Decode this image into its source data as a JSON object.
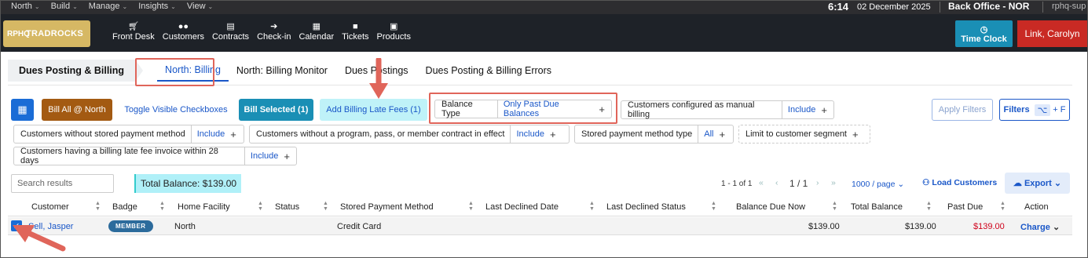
{
  "topbar": {
    "menus": [
      "North",
      "Build",
      "Manage",
      "Insights",
      "View"
    ],
    "clock": "6:14",
    "date": "02 December 2025",
    "office": "Back Office - NOR",
    "user": "rphq-sup"
  },
  "nav": {
    "logo_mono": "RPHQ",
    "logo_text": "TRADROCKS",
    "items": [
      {
        "label": "Front Desk",
        "icon": "cart-icon"
      },
      {
        "label": "Customers",
        "icon": "users-icon"
      },
      {
        "label": "Contracts",
        "icon": "contract-icon"
      },
      {
        "label": "Check-in",
        "icon": "check-in-icon"
      },
      {
        "label": "Calendar",
        "icon": "calendar-icon"
      },
      {
        "label": "Tickets",
        "icon": "chat-icon"
      },
      {
        "label": "Products",
        "icon": "boxes-icon"
      }
    ],
    "time_clock": "Time Clock",
    "user_button": "Link, Carolyn"
  },
  "tabs": {
    "breadcrumb": "Dues Posting & Billing",
    "items": [
      "North: Billing",
      "North: Billing Monitor",
      "Dues Postings",
      "Dues Posting & Billing Errors"
    ],
    "active": "North: Billing"
  },
  "toolbar": {
    "bill_all": "Bill All @ North",
    "toggle_visible": "Toggle Visible Checkboxes",
    "bill_selected": "Bill Selected (1)",
    "add_late_fees": "Add Billing Late Fees (1)",
    "apply_filters": "Apply Filters",
    "filters": "Filters",
    "filters_shortcut": "+ F"
  },
  "filters": {
    "balance_type": {
      "key": "Balance Type",
      "value": "Only Past Due Balances"
    },
    "manual_billing": {
      "key": "Customers configured as manual billing",
      "value": "Include"
    },
    "no_stored_payment": {
      "key": "Customers without stored payment method",
      "value": "Include"
    },
    "no_program": {
      "key": "Customers without a program, pass, or member contract in effect",
      "value": "Include"
    },
    "payment_type": {
      "key": "Stored payment method type",
      "value": "All"
    },
    "segment": {
      "key": "Limit to customer segment"
    },
    "late_fee_invoice": {
      "key": "Customers having a billing late fee invoice within 28 days",
      "value": "Include"
    }
  },
  "results": {
    "search_placeholder": "Search results",
    "total_balance": "Total Balance:  $139.00",
    "range": "1 - 1 of 1",
    "page": "1 / 1",
    "per_page": "1000 / page",
    "load_customers": "Load Customers",
    "export": "Export"
  },
  "table": {
    "columns": [
      "Customer",
      "Badge",
      "Home Facility",
      "Status",
      "Stored Payment Method",
      "Last Declined Date",
      "Last Declined Status",
      "Balance Due Now",
      "Total Balance",
      "Past Due",
      "Action"
    ],
    "rows": [
      {
        "customer": "Sell, Jasper",
        "badge": "MEMBER",
        "home_facility": "North",
        "status": "",
        "stored_payment": "Credit Card",
        "last_declined_date": "",
        "last_declined_status": "",
        "balance_due_now": "$139.00",
        "total_balance": "$139.00",
        "past_due": "$139.00",
        "action": "Charge",
        "checked": true
      }
    ]
  },
  "colors": {
    "accent": "#1a57c8",
    "bill_all": "#a35a12",
    "bill_selected": "#1a8fb5",
    "late_fee_bg": "#bff2f8",
    "user_button": "#c92a24",
    "past_due": "#d0021b",
    "annotation": "#e0655a"
  }
}
